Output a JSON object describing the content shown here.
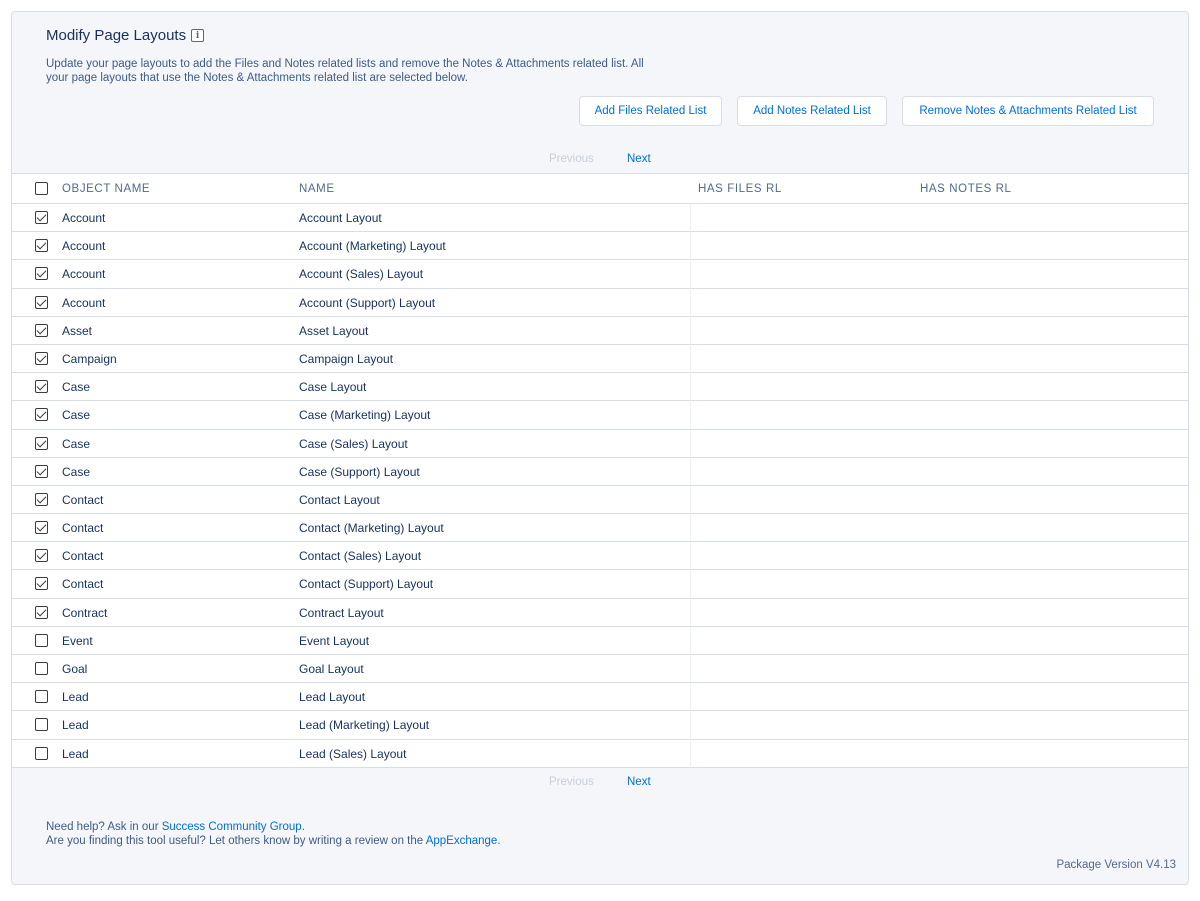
{
  "header": {
    "title": "Modify Page Layouts",
    "info_icon": "i",
    "description": "Update your page layouts to add the Files and Notes related lists and remove the Notes & Attachments related list. All your page layouts that use the Notes & Attachments related list are selected below."
  },
  "actions": {
    "add_files": "Add Files Related List",
    "add_notes": "Add Notes Related List",
    "remove_notes_attachments": "Remove Notes & Attachments Related List"
  },
  "pagination": {
    "previous": "Previous",
    "next": "Next"
  },
  "table": {
    "columns": [
      "OBJECT NAME",
      "NAME",
      "HAS FILES RL",
      "HAS NOTES RL"
    ],
    "rows": [
      {
        "object": "Account",
        "name": "Account Layout",
        "checked": true
      },
      {
        "object": "Account",
        "name": "Account (Marketing) Layout",
        "checked": true
      },
      {
        "object": "Account",
        "name": "Account (Sales) Layout",
        "checked": true
      },
      {
        "object": "Account",
        "name": "Account (Support) Layout",
        "checked": true
      },
      {
        "object": "Asset",
        "name": "Asset Layout",
        "checked": true
      },
      {
        "object": "Campaign",
        "name": "Campaign Layout",
        "checked": true
      },
      {
        "object": "Case",
        "name": "Case Layout",
        "checked": true
      },
      {
        "object": "Case",
        "name": "Case (Marketing) Layout",
        "checked": true
      },
      {
        "object": "Case",
        "name": "Case (Sales) Layout",
        "checked": true
      },
      {
        "object": "Case",
        "name": "Case (Support) Layout",
        "checked": true
      },
      {
        "object": "Contact",
        "name": "Contact Layout",
        "checked": true
      },
      {
        "object": "Contact",
        "name": "Contact (Marketing) Layout",
        "checked": true
      },
      {
        "object": "Contact",
        "name": "Contact (Sales) Layout",
        "checked": true
      },
      {
        "object": "Contact",
        "name": "Contact (Support) Layout",
        "checked": true
      },
      {
        "object": "Contract",
        "name": "Contract Layout",
        "checked": true
      },
      {
        "object": "Event",
        "name": "Event Layout",
        "checked": false
      },
      {
        "object": "Goal",
        "name": "Goal Layout",
        "checked": false
      },
      {
        "object": "Lead",
        "name": "Lead Layout",
        "checked": false
      },
      {
        "object": "Lead",
        "name": "Lead (Marketing) Layout",
        "checked": false
      },
      {
        "object": "Lead",
        "name": "Lead (Sales) Layout",
        "checked": false
      }
    ]
  },
  "footer": {
    "help_prefix": "Need help? Ask in our ",
    "help_link": "Success Community Group",
    "help_suffix": ".",
    "review_prefix": "Are you finding this tool useful? Let others know by writing a review on the ",
    "review_link": "AppExchange",
    "review_suffix": ".",
    "version": "Package Version V4.13"
  }
}
